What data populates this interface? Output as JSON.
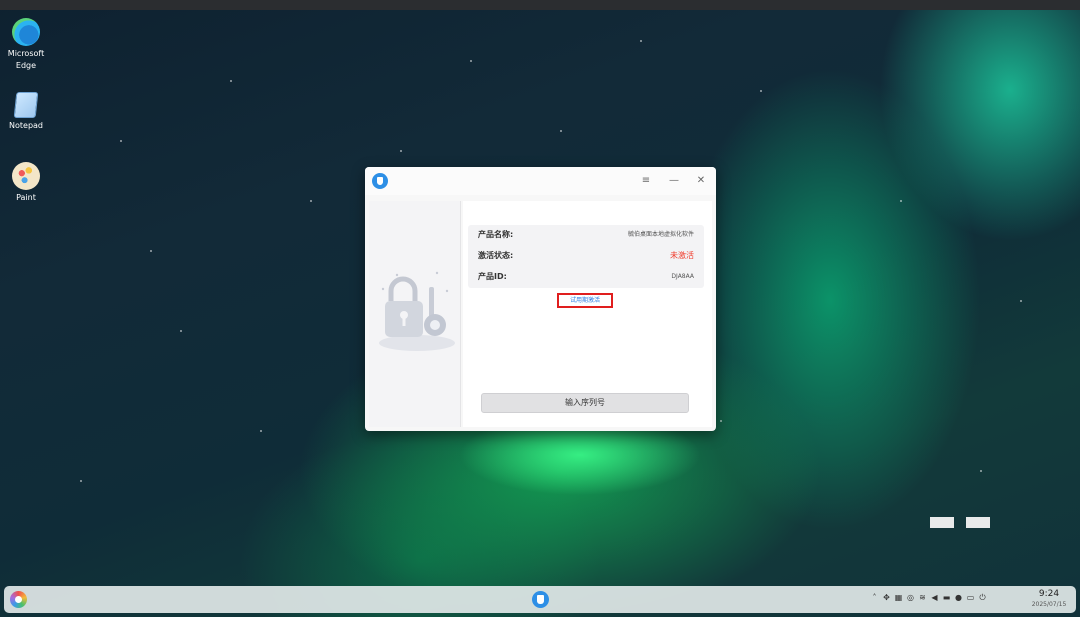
{
  "desktop": {
    "icons": [
      {
        "label_line1": "Microsoft",
        "label_line2": "Edge",
        "icon": "edge-icon"
      },
      {
        "label_line1": "Notepad",
        "label_line2": "",
        "icon": "notepad-icon"
      },
      {
        "label_line1": "Paint",
        "label_line2": "",
        "icon": "paint-icon"
      }
    ]
  },
  "window": {
    "icon": "shield-app-icon",
    "controls": {
      "menu": "≡",
      "minimize": "—",
      "close": "✕"
    },
    "info": {
      "product_name_label": "产品名称:",
      "product_name_value": "毓伯桌面本地虚拟化软件",
      "activation_status_label": "激活状态:",
      "activation_status_value": "未激活",
      "product_id_label": "产品ID:",
      "product_id_value": "DJA8AA"
    },
    "trial_button_label": "试用期激活",
    "serial_button_label": "输入序列号",
    "colors": {
      "status_red": "#f03a2a",
      "link_blue": "#2a7be4",
      "highlight_border": "#e01e1e"
    }
  },
  "taskbar": {
    "start_icon": "start-menu-icon",
    "app_icon": "shield-app-icon",
    "tray_icons": [
      "chevron-up-icon",
      "pin-icon",
      "keyboard-icon",
      "network-icon",
      "wifi-icon",
      "volume-icon",
      "display-icon",
      "mic-icon",
      "battery-icon",
      "power-icon"
    ],
    "clock_time": "9:24",
    "clock_date": "2025/07/15"
  }
}
